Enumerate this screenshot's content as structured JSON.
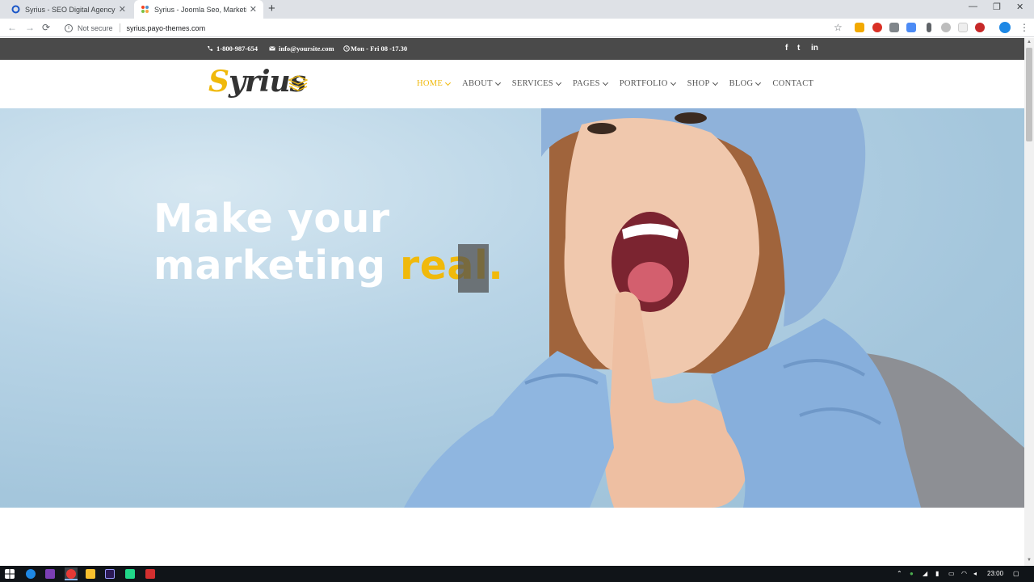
{
  "browser": {
    "tabs": [
      {
        "title": "Syrius - SEO Digital Agency Crea",
        "active": false
      },
      {
        "title": "Syrius - Joomla Seo, Marketing &",
        "active": true
      }
    ],
    "close_glyph": "✕",
    "new_tab_glyph": "+",
    "window_controls": [
      "—",
      "❐",
      "✕"
    ],
    "security_label": "Not secure",
    "url": "syrius.payo-themes.com",
    "nav": {
      "back": "←",
      "forward": "→",
      "reload": "⟳"
    },
    "star_glyph": "☆",
    "menu_glyph": "⋮"
  },
  "topbar": {
    "phone": "1-800-987-654",
    "email": "info@yoursite.com",
    "hours": "Mon - Fri 08 -17.30",
    "social": [
      "f",
      "t",
      "in"
    ]
  },
  "logo": {
    "text": "Syrius",
    "first_letter": "S",
    "rest": "yrius"
  },
  "menu": [
    {
      "label": "HOME",
      "active": true,
      "dropdown": true
    },
    {
      "label": "ABOUT",
      "active": false,
      "dropdown": true
    },
    {
      "label": "SERVICES",
      "active": false,
      "dropdown": true
    },
    {
      "label": "PAGES",
      "active": false,
      "dropdown": true
    },
    {
      "label": "PORTFOLIO",
      "active": false,
      "dropdown": true
    },
    {
      "label": "SHOP",
      "active": false,
      "dropdown": true
    },
    {
      "label": "BLOG",
      "active": false,
      "dropdown": true
    },
    {
      "label": "CONTACT",
      "active": false,
      "dropdown": false
    }
  ],
  "hero": {
    "line1": "Make your",
    "line2_plain": "marketing ",
    "line2_accent": "real."
  },
  "taskbar": {
    "time": "23:00"
  },
  "colors": {
    "accent": "#f0b90b",
    "topbar": "#4a4a4a",
    "nav_text": "#555555"
  }
}
